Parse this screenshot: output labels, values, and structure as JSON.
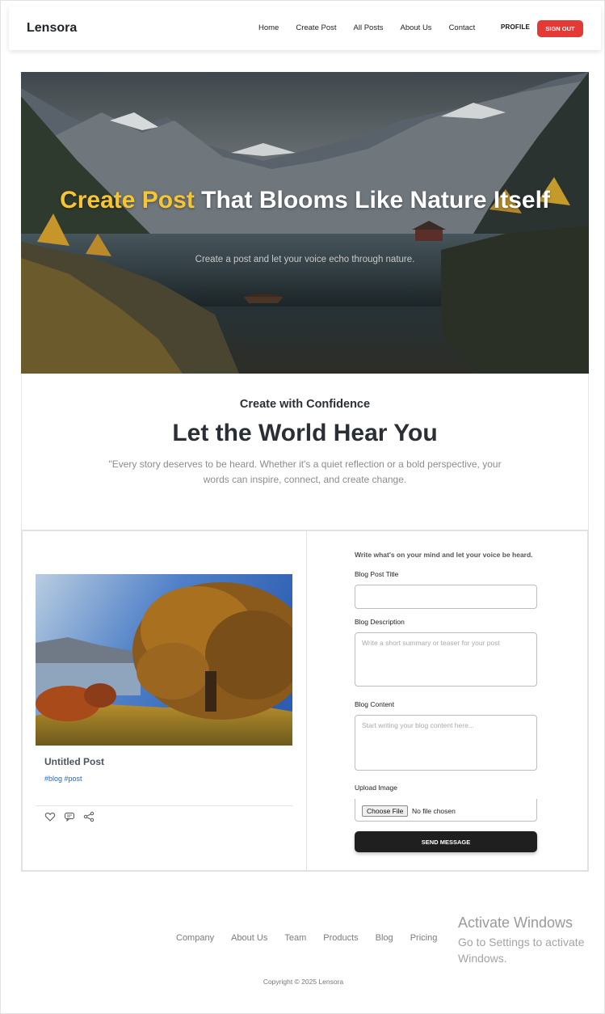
{
  "navbar": {
    "brand": "Lensora",
    "links": [
      "Home",
      "Create Post",
      "All Posts",
      "About Us",
      "Contact"
    ],
    "profile": "PROFILE",
    "signout": "SIGN OUT"
  },
  "hero": {
    "title_accent": "Create Post",
    "title_rest": "That Blooms Like Nature Itself",
    "subtitle": "Create a post and let your voice echo through nature."
  },
  "intro": {
    "kicker": "Create with Confidence",
    "title": "Let the World Hear You",
    "text": "\"Every story deserves to be heard. Whether it's a quiet reflection or a bold perspective, your words can inspire, connect, and create change."
  },
  "preview": {
    "title": "Untitled Post",
    "tags": "#blog #post",
    "icons": [
      "heart-icon",
      "comment-icon",
      "share-icon"
    ]
  },
  "form": {
    "intro": "Write what's on your mind and let your voice be heard.",
    "title_label": "Blog Post Title",
    "title_value": "",
    "description_label": "Blog Description",
    "description_placeholder": "Write a short summary or teaser for your post",
    "content_label": "Blog Content",
    "content_placeholder": "Start writing your blog content here...",
    "upload_label": "Upload Image",
    "choose_file": "Choose File",
    "no_file": "No file chosen",
    "submit": "SEND MESSAGE"
  },
  "footer": {
    "links": [
      "Company",
      "About Us",
      "Team",
      "Products",
      "Blog",
      "Pricing"
    ],
    "copyright": "Copyright © 2025 Lensora"
  },
  "watermark": {
    "title": "Activate Windows",
    "subtitle": "Go to Settings to activate Windows."
  },
  "colors": {
    "accent_yellow": "#f6c533",
    "signout_red": "#e53935",
    "button_dark": "#1f1f1f",
    "tag_blue": "#2266cc"
  }
}
